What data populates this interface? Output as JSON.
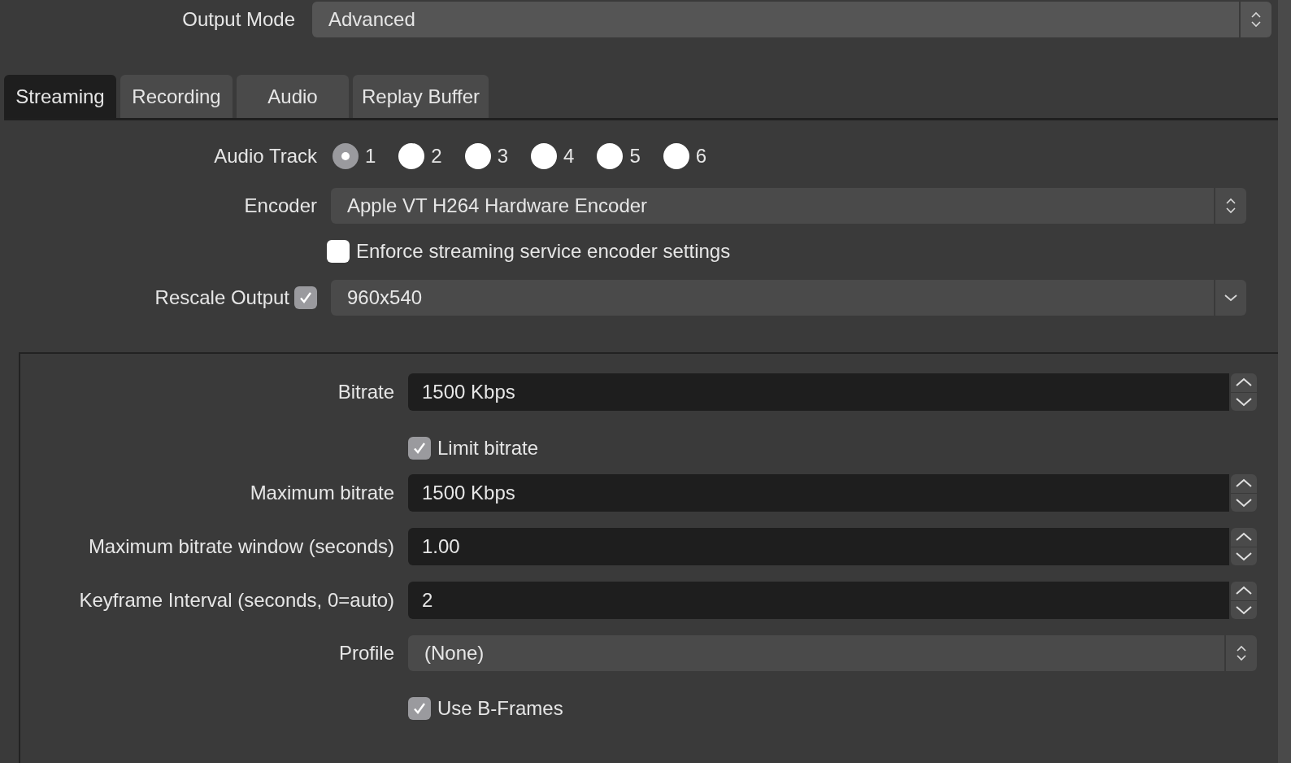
{
  "output_mode": {
    "label": "Output Mode",
    "value": "Advanced"
  },
  "tabs": [
    {
      "label": "Streaming",
      "selected": true
    },
    {
      "label": "Recording",
      "selected": false
    },
    {
      "label": "Audio",
      "selected": false
    },
    {
      "label": "Replay Buffer",
      "selected": false
    }
  ],
  "audio_track": {
    "label": "Audio Track",
    "options": [
      {
        "label": "1",
        "selected": true
      },
      {
        "label": "2",
        "selected": false
      },
      {
        "label": "3",
        "selected": false
      },
      {
        "label": "4",
        "selected": false
      },
      {
        "label": "5",
        "selected": false
      },
      {
        "label": "6",
        "selected": false
      }
    ]
  },
  "encoder": {
    "label": "Encoder",
    "value": "Apple VT H264 Hardware Encoder"
  },
  "enforce_settings": {
    "label": "Enforce streaming service encoder settings",
    "checked": false
  },
  "rescale_output": {
    "label": "Rescale Output",
    "checked": true,
    "value": "960x540"
  },
  "encoder_settings": [
    {
      "kind": "spin",
      "label": "Bitrate",
      "value": "1500 Kbps"
    },
    {
      "kind": "checkbox",
      "label": "Limit bitrate",
      "checked": true
    },
    {
      "kind": "spin",
      "label": "Maximum bitrate",
      "value": "1500 Kbps"
    },
    {
      "kind": "spin",
      "label": "Maximum bitrate window (seconds)",
      "value": "1.00"
    },
    {
      "kind": "spin",
      "label": "Keyframe Interval (seconds, 0=auto)",
      "value": "2"
    },
    {
      "kind": "combo",
      "label": "Profile",
      "value": "(None)"
    },
    {
      "kind": "checkbox",
      "label": "Use B-Frames",
      "checked": true
    }
  ]
}
